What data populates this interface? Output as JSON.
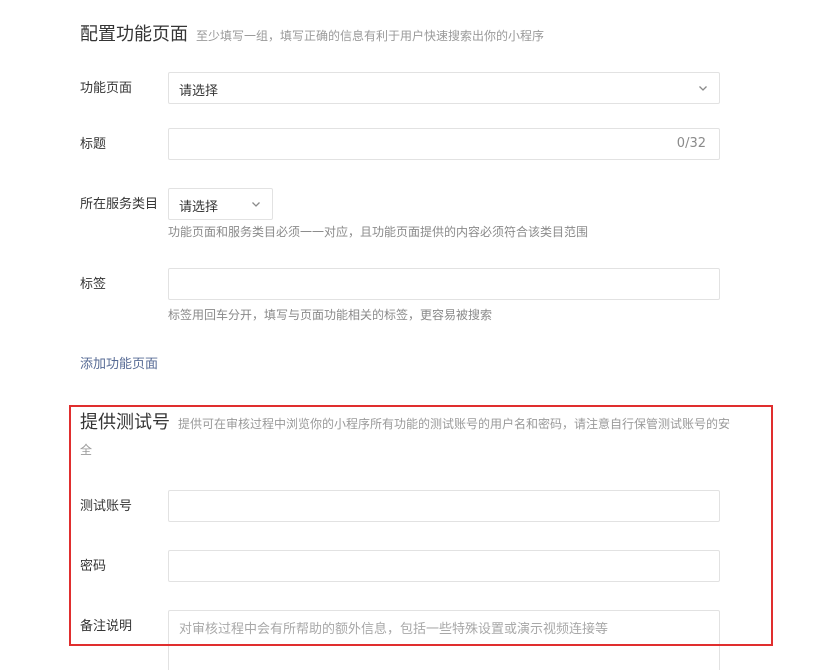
{
  "config_section": {
    "title": "配置功能页面",
    "desc": "至少填写一组，填写正确的信息有利于用户快速搜索出你的小程序"
  },
  "function_page": {
    "label": "功能页面",
    "value": "请选择",
    "icon": "chevron-down-icon"
  },
  "title_field": {
    "label": "标题",
    "value": "",
    "counter": "0/32"
  },
  "service_category": {
    "label": "所在服务类目",
    "value": "请选择",
    "icon": "chevron-down-icon",
    "hint": "功能页面和服务类目必须一一对应，且功能页面提供的内容必须符合该类目范围"
  },
  "tags": {
    "label": "标签",
    "value": "",
    "hint": "标签用回车分开，填写与页面功能相关的标签，更容易被搜索"
  },
  "add_function_page_link": "添加功能页面",
  "test_section": {
    "title": "提供测试号",
    "desc": "提供可在审核过程中浏览你的小程序所有功能的测试账号的用户名和密码，请注意自行保管测试账号的安全"
  },
  "test_account": {
    "label": "测试账号",
    "value": ""
  },
  "password": {
    "label": "密码",
    "value": ""
  },
  "remarks": {
    "label": "备注说明",
    "placeholder": "对审核过程中会有所帮助的额外信息，包括一些特殊设置或演示视频连接等"
  },
  "colors": {
    "highlight_border": "#e02e2e",
    "link": "#576b95",
    "border": "#e2e2e2"
  }
}
